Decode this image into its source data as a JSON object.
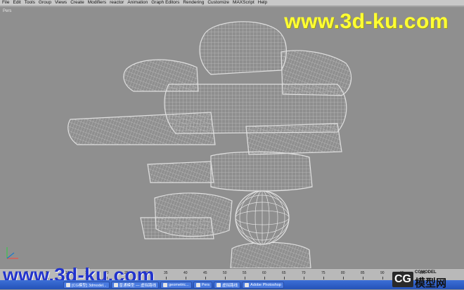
{
  "menu": {
    "items": [
      "File",
      "Edit",
      "Tools",
      "Group",
      "Views",
      "Create",
      "Modifiers",
      "reactor",
      "Animation",
      "Graph Editors",
      "Rendering",
      "Customize",
      "MAXScript",
      "Help"
    ]
  },
  "viewport": {
    "label": "Pers",
    "background": "#8f8f8f",
    "wire_color": "#d9d9d9"
  },
  "watermarks": {
    "top": "www.3d-ku.com",
    "bottom": "www.3d-ku.com",
    "top_color": "#ffff33",
    "bottom_color": "#2233cc"
  },
  "timeline": {
    "ticks": [
      "0",
      "5",
      "10",
      "15",
      "20",
      "25",
      "30",
      "35",
      "40",
      "45",
      "50",
      "55",
      "60",
      "65",
      "70",
      "75",
      "80",
      "85",
      "90",
      "95",
      "100"
    ]
  },
  "taskbar": {
    "tasks": [
      "[CG模型] 3dmodel...",
      "普通模型 — 虚拟路线",
      "geometric...",
      "Pers",
      "虚拟路线",
      "Adobe Photoshop"
    ]
  },
  "logo": {
    "mark": "CG",
    "sub": "CGMODEL",
    "main": "模型网"
  }
}
